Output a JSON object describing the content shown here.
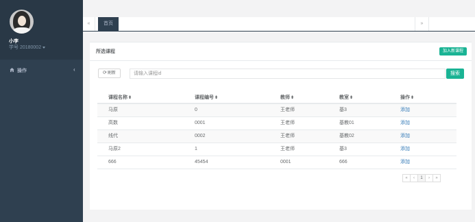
{
  "sidebar": {
    "user_name": "小李",
    "user_id": "学号 20180002",
    "nav": {
      "label": "操作"
    }
  },
  "tabs": {
    "prev": "«",
    "home": "首页",
    "next": "»"
  },
  "panel": {
    "title": "所选课程",
    "add_button": "加入新课程",
    "refresh_button": "刷新",
    "search_placeholder": "请输入课程id",
    "search_button": "搜索"
  },
  "table": {
    "headers": [
      "课程名称",
      "课程编号",
      "教师",
      "教室",
      "操作"
    ],
    "rows": [
      [
        "马原",
        "0",
        "王老师",
        "基3",
        "添加"
      ],
      [
        "高数",
        "0001",
        "王老师",
        "基教01",
        "添加"
      ],
      [
        "线代",
        "0002",
        "王老师",
        "基教02",
        "添加"
      ],
      [
        "马原2",
        "1",
        "王老师",
        "基3",
        "添加"
      ],
      [
        "666",
        "45454",
        "0001",
        "666",
        "添加"
      ]
    ]
  },
  "pagination": [
    "«",
    "‹",
    "1",
    "›",
    "»"
  ],
  "colors": {
    "sidebar": "#2f4050",
    "accent": "#1ab394",
    "link": "#337ab7"
  }
}
